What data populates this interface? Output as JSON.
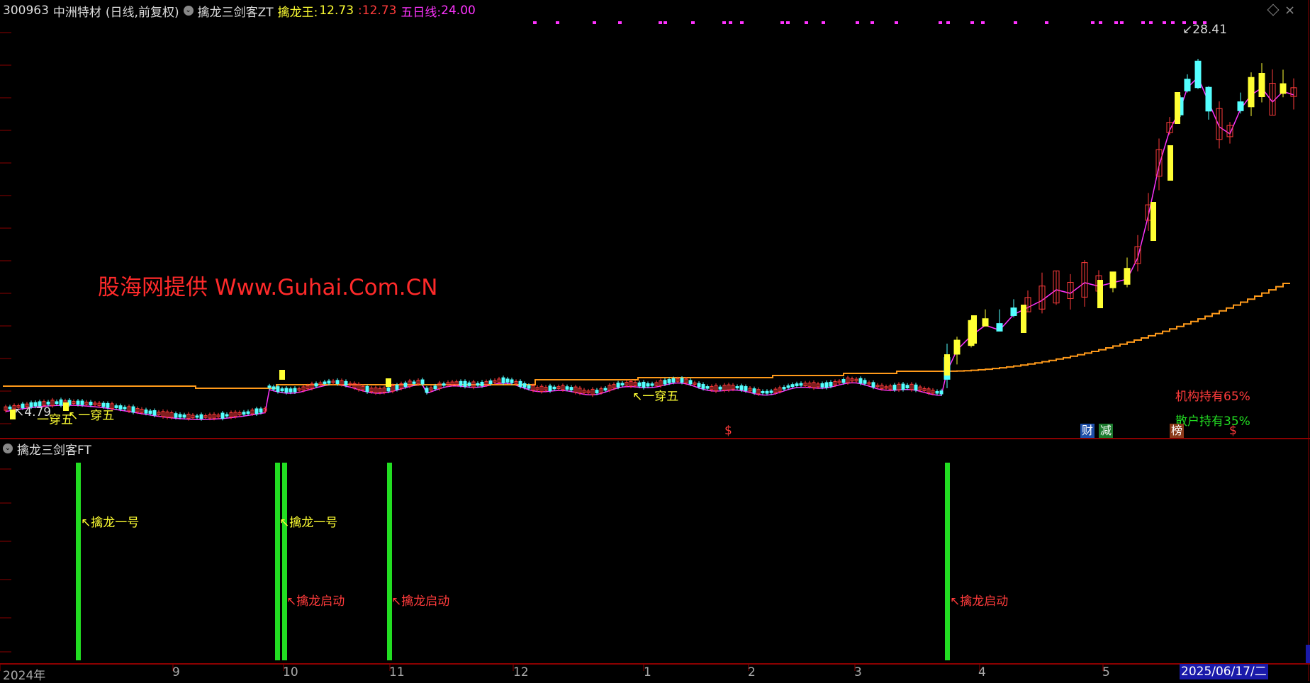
{
  "header": {
    "code": "300963",
    "name": "中洲特材",
    "period": "(日线,前复权)",
    "indicator": "擒龙三剑客ZT",
    "qlw_label": "擒龙王:",
    "qlw_value1": "12.73",
    "qlw_value2": "12.73",
    "ma5_label": "五日线:",
    "ma5_value": "24.00"
  },
  "sub_header": {
    "indicator": "擒龙三剑客FT"
  },
  "watermark": "股海网提供 Www.Guhai.Com.CN",
  "annotations": {
    "low_price": "4.79",
    "high_price": "28.41",
    "yichuanwu_1": "一穿五",
    "yichuanwu_2": "一穿五",
    "yichuanwu_3": "一穿五",
    "institution": "机构持有65%",
    "retail": "散户持有35%",
    "badge_cai": "财",
    "badge_jian": "减",
    "badge_bang": "榜",
    "dollar_1": "$",
    "dollar_2": "$"
  },
  "sub_signals": {
    "qinlong_yihao_1": "擒龙一号",
    "qinlong_yihao_2": "擒龙一号",
    "qidong_1": "擒龙启动",
    "qidong_2": "擒龙启动",
    "qidong_3": "擒龙启动"
  },
  "x_axis": [
    "2024年",
    "9",
    "10",
    "11",
    "12",
    "1",
    "2",
    "3",
    "4",
    "5"
  ],
  "date_badge": "2025/06/17/二",
  "colors": {
    "bg": "#000000",
    "up": "#ff3b3b",
    "down": "#54ffff",
    "yellow": "#ffff33",
    "green": "#22dd22",
    "orange": "#ff9a1a",
    "magenta": "#ff33ff",
    "axis": "#8b0000"
  },
  "icons": [
    "circle-collapse-icon",
    "diamond-icon",
    "close-icon"
  ]
}
